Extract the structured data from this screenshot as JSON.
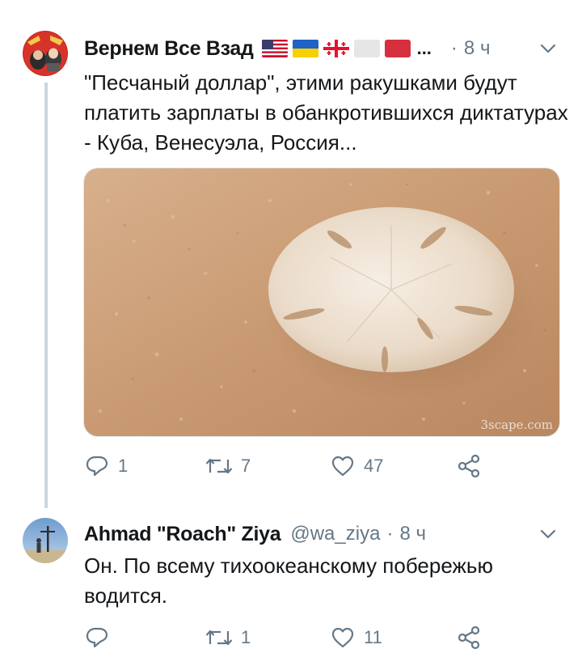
{
  "tweet1": {
    "display_name": "Вернем Все Взад",
    "extra_marker": "...",
    "separator": "·",
    "time": "8 ч",
    "text": "\"Песчаный доллар\", этими ракушками будут платить зарплаты в обанкротившихся диктатурах - Куба, Венесуэла, Россия...",
    "media_watermark": "3scape.com",
    "replies": "1",
    "retweets": "7",
    "likes": "47"
  },
  "tweet2": {
    "display_name": "Ahmad \"Roach\" Ziya",
    "handle": "@wa_ziya",
    "separator": "·",
    "time": "8 ч",
    "text": "Он. По всему тихоокеанскому побережью водится.",
    "replies": "",
    "retweets": "1",
    "likes": "11"
  },
  "icons": [
    "reply-icon",
    "retweet-icon",
    "like-icon",
    "share-icon",
    "chevron-down-icon"
  ],
  "colors": {
    "muted_text": "#657786",
    "thread_line": "#ccd6dd",
    "primary_text": "#14171a"
  }
}
